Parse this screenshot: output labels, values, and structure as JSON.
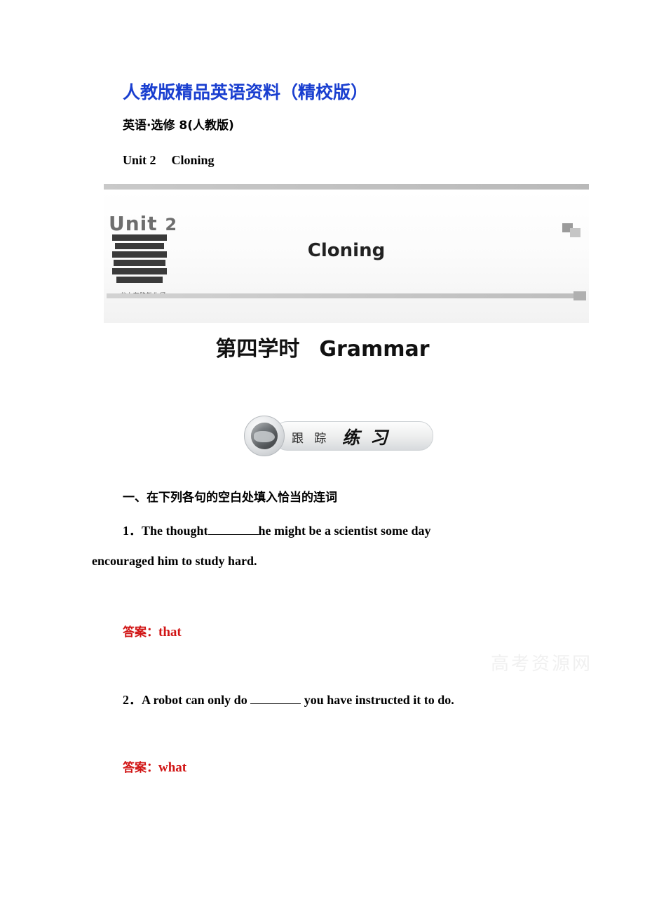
{
  "header": {
    "title_cn": "人教版精品英语资料",
    "title_paren": "（精校版）",
    "subject_line": "英语·选修 8(人教版)",
    "unit_label": "Unit 2",
    "unit_name": "Cloning"
  },
  "banner": {
    "unit_word": "Unit",
    "unit_number": "2",
    "title": "Cloning",
    "books_caption": "书山有路勤为径"
  },
  "section": {
    "period": "第四学时",
    "name": "Grammar"
  },
  "practice_badge": {
    "label_cn": "跟 踪",
    "label_main": "练 习"
  },
  "exercise": {
    "heading": "一、在下列各句的空白处填入恰当的连词",
    "items": [
      {
        "number": "1．",
        "line1_a": "The  thought",
        "line1_b": "he  might  be  a  scientist  some  day",
        "line2": "encouraged him to study hard.",
        "answer_label": "答案：",
        "answer_value": "that"
      },
      {
        "number": "2．",
        "text_a": "A robot can only do",
        "text_b": "you have instructed it to do.",
        "answer_label": "答案：",
        "answer_value": "what"
      }
    ]
  },
  "watermark": {
    "text": "高考资源网"
  },
  "colors": {
    "title_blue": "#1a3fd0",
    "answer_red": "#d11515",
    "banner_gray": "#6e6e6e"
  }
}
